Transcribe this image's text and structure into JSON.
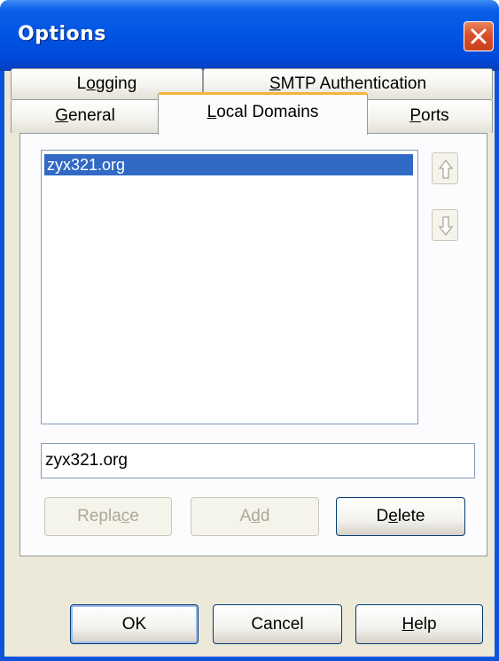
{
  "window": {
    "title": "Options"
  },
  "tabs": {
    "row1": [
      {
        "pre": "L",
        "u": "o",
        "post": "gging"
      },
      {
        "pre": "",
        "u": "S",
        "post": "MTP Authentication"
      }
    ],
    "row2": [
      {
        "pre": "",
        "u": "G",
        "post": "eneral"
      },
      {
        "pre": "",
        "u": "L",
        "post": "ocal Domains"
      },
      {
        "pre": "",
        "u": "P",
        "post": "orts"
      }
    ],
    "active": "Local Domains"
  },
  "domains": {
    "items": [
      "zyx321.org"
    ],
    "selected_index": 0,
    "input_value": "zyx321.org"
  },
  "actions": {
    "replace": {
      "pre": "Repla",
      "u": "c",
      "post": "e"
    },
    "add": {
      "pre": "A",
      "u": "d",
      "post": "d"
    },
    "delete": {
      "pre": "D",
      "u": "e",
      "post": "lete"
    }
  },
  "footer": {
    "ok": "OK",
    "cancel": "Cancel",
    "help": {
      "pre": "",
      "u": "H",
      "post": "elp"
    }
  },
  "colors": {
    "titlebar": "#0054e3",
    "selection": "#316ac5",
    "active_tab_accent": "#f3b33a",
    "close_button": "#d9502a",
    "face": "#ece9d8"
  }
}
